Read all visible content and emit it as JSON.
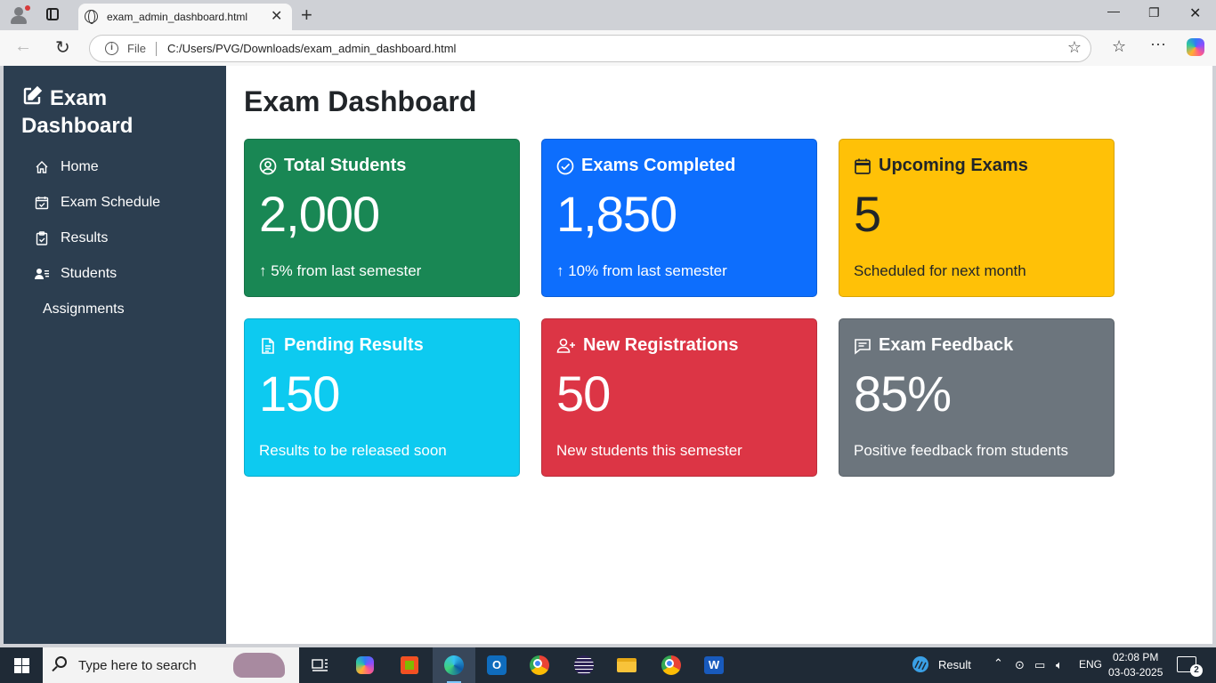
{
  "browser": {
    "tab_title": "exam_admin_dashboard.html",
    "address_scheme": "File",
    "address_url": "C:/Users/PVG/Downloads/exam_admin_dashboard.html"
  },
  "sidebar": {
    "brand": "Exam Dashboard",
    "items": [
      {
        "label": "Home",
        "icon": "home-icon"
      },
      {
        "label": "Exam Schedule",
        "icon": "calendar-check-icon"
      },
      {
        "label": "Results",
        "icon": "clipboard-check-icon"
      },
      {
        "label": "Students",
        "icon": "person-lines-icon"
      },
      {
        "label": "Assignments",
        "icon": ""
      }
    ]
  },
  "main": {
    "title": "Exam Dashboard",
    "cards": [
      {
        "title": "Total Students",
        "value": "2,000",
        "note": "↑ 5% from last semester",
        "color": "#198754",
        "text_color": "#ffffff",
        "icon": "person-circle-icon"
      },
      {
        "title": "Exams Completed",
        "value": "1,850",
        "note": "↑ 10% from last semester",
        "color": "#0d6efd",
        "text_color": "#ffffff",
        "icon": "check-circle-icon"
      },
      {
        "title": "Upcoming Exams",
        "value": "5",
        "note": "Scheduled for next month",
        "color": "#ffc107",
        "text_color": "#212529",
        "icon": "calendar-icon"
      },
      {
        "title": "Pending Results",
        "value": "150",
        "note": "Results to be released soon",
        "color": "#0dcaf0",
        "text_color": "#ffffff",
        "icon": "file-text-icon"
      },
      {
        "title": "New Registrations",
        "value": "50",
        "note": "New students this semester",
        "color": "#dc3545",
        "text_color": "#ffffff",
        "icon": "person-plus-icon"
      },
      {
        "title": "Exam Feedback",
        "value": "85%",
        "note": "Positive feedback from students",
        "color": "#6c757d",
        "text_color": "#ffffff",
        "icon": "chat-text-icon"
      }
    ]
  },
  "taskbar": {
    "search_placeholder": "Type here to search",
    "weather_label": "Result",
    "language": "ENG",
    "time": "02:08 PM",
    "date": "03-03-2025",
    "notification_count": "2"
  }
}
